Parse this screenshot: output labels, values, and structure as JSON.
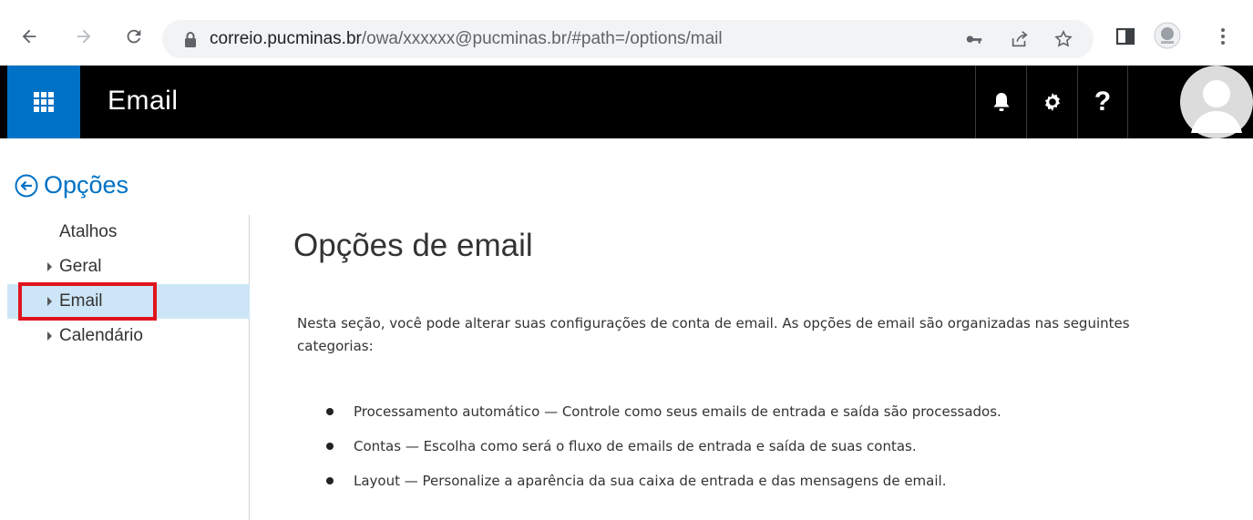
{
  "browser": {
    "url_host": "correio.pucminas.br",
    "url_path1": "/owa/",
    "url_user": "xxxxxx",
    "url_rest": "@pucminas.br/#path=/options/mail"
  },
  "header": {
    "app_title": "Email",
    "help_label": "?"
  },
  "options": {
    "title": "Opções"
  },
  "sidebar": {
    "items": [
      {
        "label": "Atalhos",
        "has_arrow": false,
        "selected": false
      },
      {
        "label": "Geral",
        "has_arrow": true,
        "selected": false
      },
      {
        "label": "Email",
        "has_arrow": true,
        "selected": true
      },
      {
        "label": "Calendário",
        "has_arrow": true,
        "selected": false
      }
    ]
  },
  "main": {
    "title": "Opções de email",
    "intro": "Nesta seção, você pode alterar suas configurações de conta de email. As opções de email são organizadas nas seguintes categorias:",
    "bullets": [
      "Processamento automático — Controle como seus emails de entrada e saída são processados.",
      "Contas — Escolha como será o fluxo de emails de entrada e saída de suas contas.",
      "Layout — Personalize a aparência da sua caixa de entrada e das mensagens de email."
    ]
  },
  "colors": {
    "accent": "#0072c6",
    "header_bg": "#000000",
    "selected_bg": "#cde6f7",
    "highlight": "#e0141e"
  }
}
